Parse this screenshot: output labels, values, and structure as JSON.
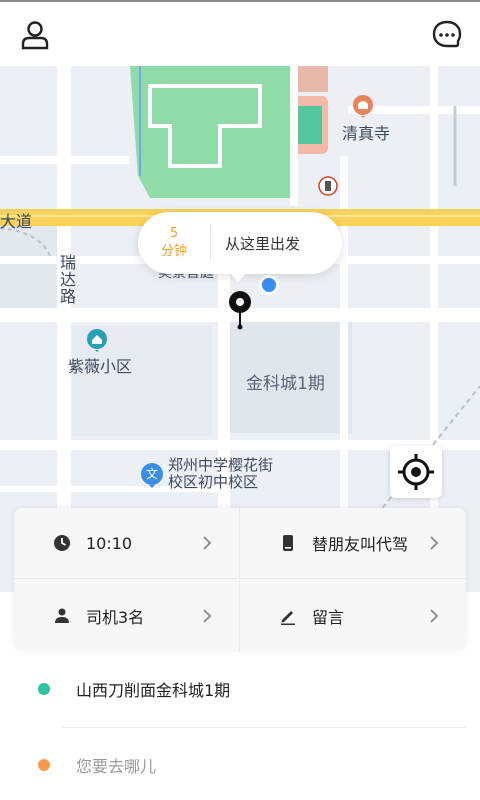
{
  "header": {
    "user_icon": "user-icon",
    "message_icon": "chat-bubble-icon"
  },
  "map": {
    "labels": {
      "dadao": "大道",
      "ruida_road": "瑞达路",
      "qingzhensi": "清真寺",
      "ziwei": "紫薇小区",
      "jinkecheng": "金科城1期",
      "school": "郑州中学樱花街\n校区初中校区",
      "under_bubble": "美景音庭"
    },
    "colors": {
      "highway": "#f8d25a",
      "park": "#8fdca8",
      "road": "#ffffff",
      "block": "#e2e6ed"
    }
  },
  "bubble": {
    "eta_number": "5",
    "eta_unit": "分钟",
    "depart_text": "从这里出发"
  },
  "options": {
    "time": "10:10",
    "for_friend": "替朋友叫代驾",
    "drivers": "司机3名",
    "note": "留言"
  },
  "addresses": {
    "from": "山西刀削面金科城1期",
    "from_color": "#2bc4a3",
    "to_placeholder": "您要去哪儿",
    "to_color": "#f79a4b"
  }
}
